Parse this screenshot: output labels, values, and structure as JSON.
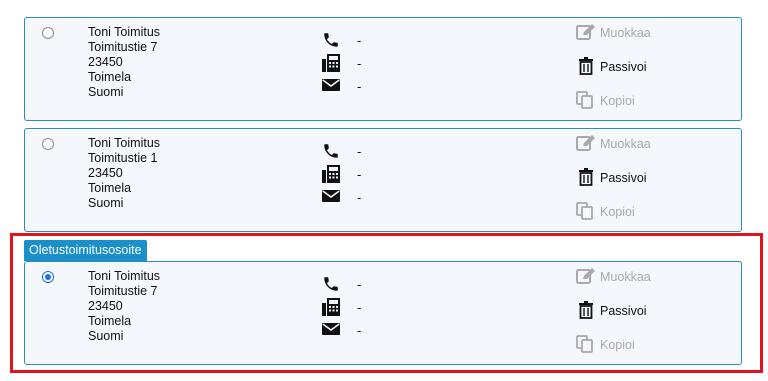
{
  "default_label": "Oletustoimitusosoite",
  "addresses": [
    {
      "name": "Toni Toimitus",
      "street": "Toimitustie 7",
      "postal_code": "23450",
      "city": "Toimela",
      "country": "Suomi",
      "phone": "-",
      "fax": "-",
      "email": "-",
      "selected": false
    },
    {
      "name": "Toni Toimitus",
      "street": "Toimitustie 1",
      "postal_code": "23450",
      "city": "Toimela",
      "country": "Suomi",
      "phone": "-",
      "fax": "-",
      "email": "-",
      "selected": false
    },
    {
      "name": "Toni Toimitus",
      "street": "Toimitustie 7",
      "postal_code": "23450",
      "city": "Toimela",
      "country": "Suomi",
      "phone": "-",
      "fax": "-",
      "email": "-",
      "selected": true
    }
  ],
  "actions": {
    "edit_label": "Muokkaa",
    "deactivate_label": "Passivoi",
    "copy_label": "Kopioi"
  },
  "colors": {
    "card_border": "#2a8fb5",
    "card_background": "#f4f7fc",
    "default_tab": "#1a8fc9",
    "highlight": "#e0141e",
    "disabled_text": "#a9a9a9",
    "radio_checked": "#1a73e8"
  }
}
